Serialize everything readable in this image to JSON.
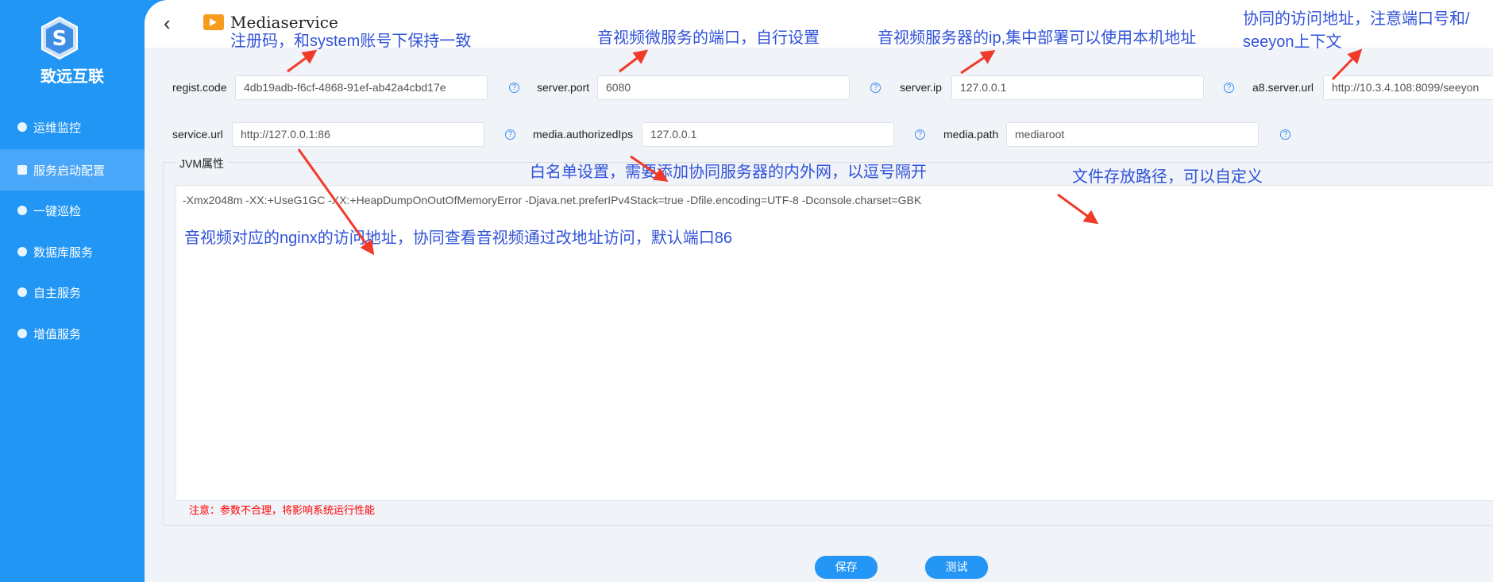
{
  "sidebar": {
    "brand": "致远互联",
    "items": [
      {
        "label": "运维监控",
        "active": false
      },
      {
        "label": "服务启动配置",
        "active": true
      },
      {
        "label": "一键巡检",
        "active": false
      },
      {
        "label": "数据库服务",
        "active": false
      },
      {
        "label": "自主服务",
        "active": false
      },
      {
        "label": "增值服务",
        "active": false
      }
    ]
  },
  "header": {
    "title": "Mediaservice",
    "back_icon": "chevron-left",
    "service_icon": "video-camera"
  },
  "form": {
    "regist_code": {
      "label": "regist.code",
      "value": "4db19adb-f6cf-4868-91ef-ab42a4cbd17e"
    },
    "server_port": {
      "label": "server.port",
      "value": "6080"
    },
    "server_ip": {
      "label": "server.ip",
      "value": "127.0.0.1"
    },
    "a8_server_url": {
      "label": "a8.server.url",
      "value": "http://10.3.4.108:8099/seeyon"
    },
    "service_url": {
      "label": "service.url",
      "value": "http://127.0.0.1:86"
    },
    "media_authorizedIps": {
      "label": "media.authorizedIps",
      "value": "127.0.0.1"
    },
    "media_path": {
      "label": "media.path",
      "value": "mediaroot"
    },
    "help": "?",
    "jvm": {
      "legend": "JVM属性",
      "value": "-Xmx2048m -XX:+UseG1GC -XX:+HeapDumpOnOutOfMemoryError -Djava.net.preferIPv4Stack=true -Dfile.encoding=UTF-8 -Dconsole.charset=GBK"
    },
    "warning": "注意：参数不合理，将影响系统运行性能"
  },
  "buttons": {
    "save": "保存",
    "test": "测试"
  },
  "annotations": {
    "regist": "注册码，和system账号下保持一致",
    "port": "音视频微服务的端口，自行设置",
    "ip": "音视频服务器的ip,集中部署可以使用本机地址",
    "a8_line1": "协同的访问地址，注意端口号和/",
    "a8_line2": "seeyon上下文",
    "ips": "白名单设置，需要添加协同服务器的内外网，以逗号隔开",
    "path": "文件存放路径，可以自定义",
    "nginx": "音视频对应的nginx的访问地址，协同查看音视频通过改地址访问，默认端口86"
  },
  "colors": {
    "sidebar": "#2196f5",
    "active_item": "#4aa6f8",
    "annotation": "#3152d9",
    "arrow": "#f03a2a",
    "warning": "#ff0000",
    "button": "#2496f6"
  }
}
